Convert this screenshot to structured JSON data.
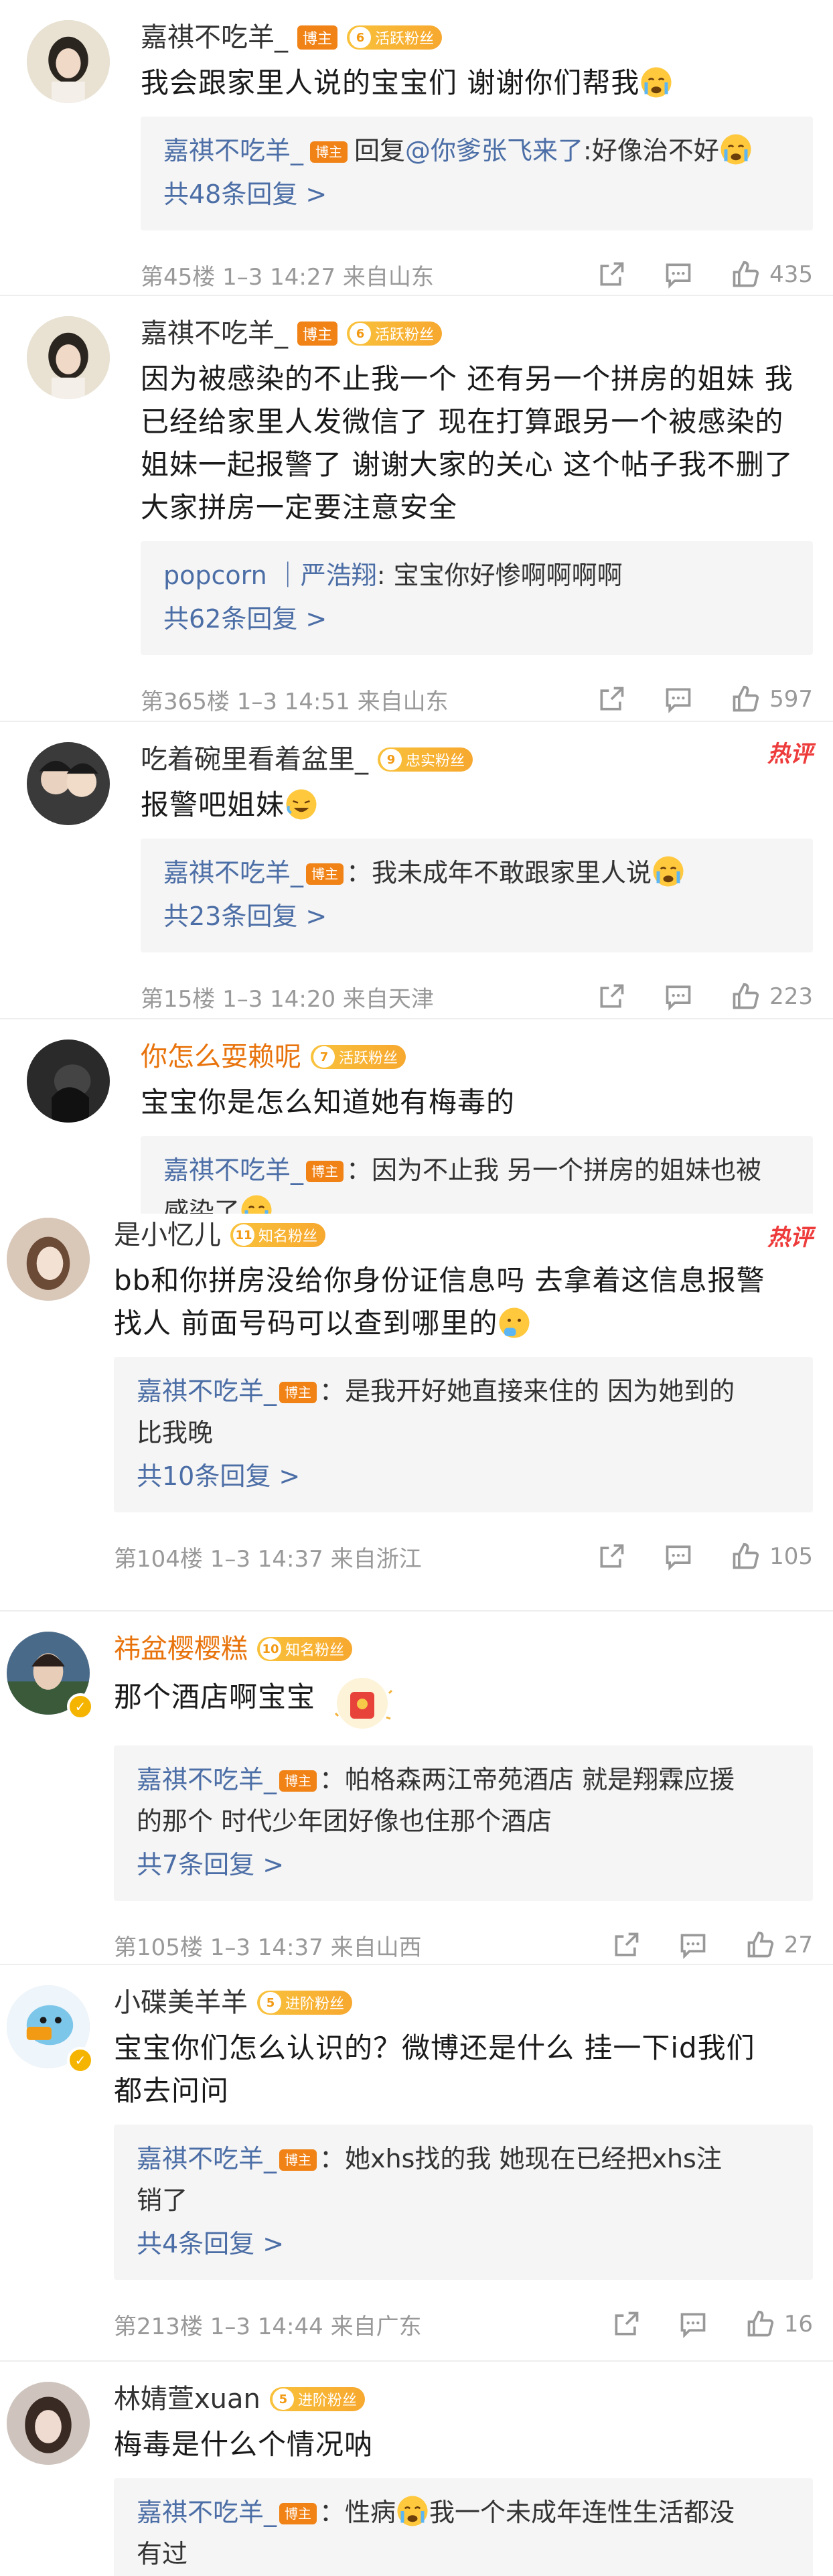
{
  "badges": {
    "blogger": "博主"
  },
  "comments": [
    {
      "username": "嘉祺不吃羊_",
      "is_blogger": true,
      "fan": {
        "level": "6",
        "label": "活跃粉丝"
      },
      "text": "我会跟家里人说的宝宝们 谢谢你们帮我",
      "reply": {
        "name": "嘉祺不吃羊_",
        "prefix": "回复",
        "mention": "@你爹张飞来了",
        "content": ":好像治不好"
      },
      "reply_count": "共48条回复 >",
      "meta": "第45楼 1–3 14:27 来自山东",
      "likes": "435"
    },
    {
      "username": "嘉祺不吃羊_",
      "is_blogger": true,
      "fan": {
        "level": "6",
        "label": "活跃粉丝"
      },
      "text_lines": [
        "因为被感染的不止我一个 还有另一个拼房的姐妹 我",
        "已经给家里人发微信了 现在打算跟另一个被感染的",
        "姐妹一起报警了 谢谢大家的关心 这个帖子我不删了",
        "大家拼房一定要注意安全"
      ],
      "reply": {
        "name": "popcorn ｜严浩翔",
        "content": ": 宝宝你好惨啊啊啊啊"
      },
      "reply_count": "共62条回复 >",
      "meta": "第365楼 1–3 14:51 来自山东",
      "likes": "597"
    },
    {
      "username": "吃着碗里看着盆里_",
      "fan": {
        "level": "9",
        "label": "忠实粉丝"
      },
      "hot": "热评",
      "text": "报警吧姐妹",
      "reply": {
        "name": "嘉祺不吃羊_",
        "content": "：我未成年不敢跟家里人说"
      },
      "reply_count": "共23条回复 >",
      "meta": "第15楼 1–3 14:20 来自天津",
      "likes": "223"
    },
    {
      "username": "你怎么耍赖呢",
      "fan": {
        "level": "7",
        "label": "活跃粉丝"
      },
      "text": "宝宝你是怎么知道她有梅毒的",
      "reply": {
        "name": "嘉祺不吃羊_",
        "content": "：因为不止我 另一个拼房的姐妹也被",
        "content2": "感染了"
      }
    },
    {
      "username": "是小忆儿",
      "fan": {
        "level": "11",
        "label": "知名粉丝"
      },
      "hot": "热评",
      "text_lines": [
        "bb和你拼房没给你身份证信息吗 去拿着这信息报警",
        "找人 前面号码可以查到哪里的"
      ],
      "reply": {
        "name": "嘉祺不吃羊_",
        "content": "：是我开好她直接来住的 因为她到的",
        "content2": "比我晚"
      },
      "reply_count": "共10条回复 >",
      "meta": "第104楼 1–3 14:37 来自浙江",
      "likes": "105"
    },
    {
      "username": "祎盆樱樱糕",
      "fan": {
        "level": "10",
        "label": "知名粉丝"
      },
      "text": "那个酒店啊宝宝",
      "reply": {
        "name": "嘉祺不吃羊_",
        "content": "：帕格森两江帝苑酒店 就是翔霖应援",
        "content2": "的那个 时代少年团好像也住那个酒店"
      },
      "reply_count": "共7条回复 >",
      "meta": "第105楼 1–3 14:37 来自山西",
      "likes": "27"
    },
    {
      "username": "小碟美羊羊",
      "fan": {
        "level": "5",
        "label": "进阶粉丝"
      },
      "text_lines": [
        "宝宝你们怎么认识的？微博还是什么 挂一下id我们",
        "都去问问"
      ],
      "reply": {
        "name": "嘉祺不吃羊_",
        "content": "：她xhs找的我 她现在已经把xhs注",
        "content2": "销了"
      },
      "reply_count": "共4条回复 >",
      "meta": "第213楼 1–3 14:44 来自广东",
      "likes": "16"
    },
    {
      "username": "林婧萱xuan",
      "fan": {
        "level": "5",
        "label": "进阶粉丝"
      },
      "text": "梅毒是什么个情况呐",
      "reply": {
        "name": "嘉祺不吃羊_",
        "content": "：性病",
        "content_after": "我一个未成年连性生活都没",
        "content2": "有过"
      }
    }
  ]
}
